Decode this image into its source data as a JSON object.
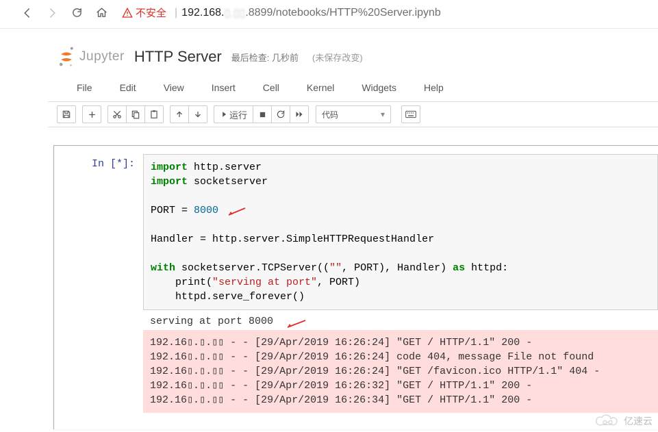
{
  "browser": {
    "not_secure": "不安全",
    "url_host": "192.168.",
    "url_blur": "▯.▯▯",
    "url_rest": ".8899/notebooks/HTTP%20Server.ipynb"
  },
  "header": {
    "logo_text": "Jupyter",
    "title": "HTTP Server",
    "last_check_prefix": "最后检查:",
    "last_check_value": "几秒前",
    "unsaved": "(未保存改变)"
  },
  "menu": {
    "file": "File",
    "edit": "Edit",
    "view": "View",
    "insert": "Insert",
    "cell": "Cell",
    "kernel": "Kernel",
    "widgets": "Widgets",
    "help": "Help"
  },
  "toolbar": {
    "run": "运行",
    "celltype": "代码"
  },
  "cell": {
    "prompt": "In  [*]:",
    "code_l1": "import",
    "code_l1b": " http.server",
    "code_l2": "import",
    "code_l2b": " socketserver",
    "code_l3a": "PORT = ",
    "code_l3b": "8000",
    "code_l4": "Handler = http.server.SimpleHTTPRequestHandler",
    "code_l5a": "with",
    "code_l5b": " socketserver.TCPServer((",
    "code_l5c": "\"\"",
    "code_l5d": ", PORT), Handler) ",
    "code_l5e": "as",
    "code_l5f": " httpd:",
    "code_l6a": "    print(",
    "code_l6b": "\"serving at port\"",
    "code_l6c": ", PORT)",
    "code_l7": "    httpd.serve_forever()"
  },
  "output": {
    "stdout": "serving at port 8000",
    "stderr1": "192.16▯.▯.▯▯ - - [29/Apr/2019 16:26:24] \"GET / HTTP/1.1\" 200 -",
    "stderr2": "192.16▯.▯.▯▯ - - [29/Apr/2019 16:26:24] code 404, message File not found",
    "stderr3": "192.16▯.▯.▯▯ - - [29/Apr/2019 16:26:24] \"GET /favicon.ico HTTP/1.1\" 404 -",
    "stderr4": "192.16▯.▯.▯▯ - - [29/Apr/2019 16:26:32] \"GET / HTTP/1.1\" 200 -",
    "stderr5": "192.16▯.▯.▯▯ - - [29/Apr/2019 16:26:34] \"GET / HTTP/1.1\" 200 -"
  },
  "watermark": {
    "text": "亿速云"
  }
}
